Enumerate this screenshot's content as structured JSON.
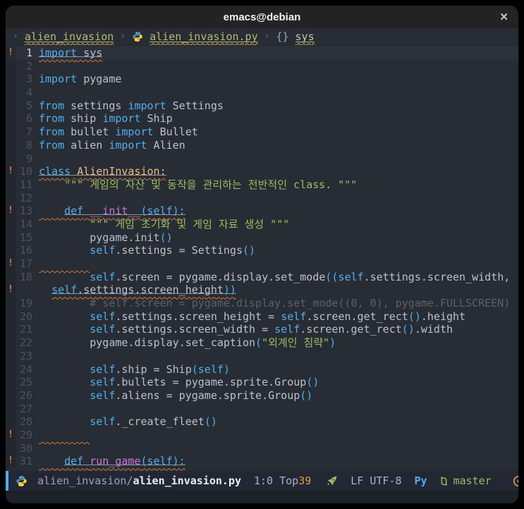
{
  "window": {
    "title": "emacs@debian",
    "close_label": "✕"
  },
  "breadcrumb": {
    "chevron": "›",
    "project": "alien_invasion",
    "file": "alien_invasion.py",
    "symbol_braces": "{}",
    "symbol": "sys"
  },
  "code": {
    "lines": [
      {
        "n": "1",
        "fringe": "!",
        "cur": true,
        "seg": [
          [
            "kw",
            "import",
            "uw"
          ],
          [
            "d",
            " sys",
            "uw"
          ]
        ]
      },
      {
        "n": "2",
        "seg": []
      },
      {
        "n": "3",
        "seg": [
          [
            "kw",
            "import"
          ],
          [
            "d",
            " pygame"
          ]
        ]
      },
      {
        "n": "4",
        "seg": []
      },
      {
        "n": "5",
        "seg": [
          [
            "kw",
            "from"
          ],
          [
            "d",
            " settings "
          ],
          [
            "kw",
            "import"
          ],
          [
            "d",
            " Settings"
          ]
        ]
      },
      {
        "n": "6",
        "seg": [
          [
            "kw",
            "from"
          ],
          [
            "d",
            " ship "
          ],
          [
            "kw",
            "import"
          ],
          [
            "d",
            " Ship"
          ]
        ]
      },
      {
        "n": "7",
        "seg": [
          [
            "kw",
            "from"
          ],
          [
            "d",
            " bullet "
          ],
          [
            "kw",
            "import"
          ],
          [
            "d",
            " Bullet"
          ]
        ]
      },
      {
        "n": "8",
        "seg": [
          [
            "kw",
            "from"
          ],
          [
            "d",
            " alien "
          ],
          [
            "kw",
            "import"
          ],
          [
            "d",
            " Alien"
          ]
        ]
      },
      {
        "n": "9",
        "seg": []
      },
      {
        "n": "10",
        "fringe": "!",
        "seg": [
          [
            "kw",
            "class",
            "uw"
          ],
          [
            "d",
            " ",
            "uw"
          ],
          [
            "type",
            "AlienInvasion",
            "uw"
          ],
          [
            "d",
            ":",
            "uw"
          ]
        ]
      },
      {
        "n": "11",
        "seg": [
          [
            "d",
            "    "
          ],
          [
            "str",
            "\"\"\" 게임의 자산 및 동작을 관리하는 전반적인 class. \"\"\""
          ]
        ]
      },
      {
        "n": "12",
        "seg": []
      },
      {
        "n": "13",
        "fringe": "!",
        "seg": [
          [
            "d",
            "    ",
            "w"
          ],
          [
            "kw",
            "def",
            "uw"
          ],
          [
            "d",
            " ",
            "uw"
          ],
          [
            "fn",
            "__init__",
            "uw"
          ],
          [
            "kw",
            "(self):",
            "uw"
          ]
        ]
      },
      {
        "n": "14",
        "seg": [
          [
            "d",
            "        "
          ],
          [
            "str",
            "\"\"\" 게임 초기화 및 게임 자료 생성 \"\"\""
          ]
        ]
      },
      {
        "n": "15",
        "seg": [
          [
            "d",
            "        pygame.init"
          ],
          [
            "kw",
            "()"
          ]
        ]
      },
      {
        "n": "16",
        "seg": [
          [
            "d",
            "        "
          ],
          [
            "kw",
            "self"
          ],
          [
            "d",
            ".settings = Settings"
          ],
          [
            "kw",
            "()"
          ]
        ]
      },
      {
        "n": "17",
        "fringe": "!",
        "seg": [
          [
            "d",
            "        ",
            "w"
          ]
        ]
      },
      {
        "n": "18",
        "seg": [
          [
            "d",
            "        "
          ],
          [
            "kw",
            "self"
          ],
          [
            "d",
            ".screen = pygame.display.set_mode"
          ],
          [
            "kw",
            "(("
          ],
          [
            "kw",
            "self"
          ],
          [
            "d",
            ".settings.screen_width,"
          ]
        ]
      },
      {
        "n": "",
        "fringe": "!",
        "seg": [
          [
            "d",
            "  "
          ],
          [
            "kw",
            "self",
            "uw"
          ],
          [
            "d",
            ".settings.screen_height",
            "uw"
          ],
          [
            "kw",
            "))",
            "uw"
          ]
        ]
      },
      {
        "n": "19",
        "seg": [
          [
            "cmt",
            "        # self.screen = pygame.display.set_mode((0, 0), pygame.FULLSCREEN)"
          ]
        ]
      },
      {
        "n": "20",
        "seg": [
          [
            "d",
            "        "
          ],
          [
            "kw",
            "self"
          ],
          [
            "d",
            ".settings.screen_height = "
          ],
          [
            "kw",
            "self"
          ],
          [
            "d",
            ".screen.get_rect"
          ],
          [
            "kw",
            "()"
          ],
          [
            "d",
            ".height"
          ]
        ]
      },
      {
        "n": "21",
        "seg": [
          [
            "d",
            "        "
          ],
          [
            "kw",
            "self"
          ],
          [
            "d",
            ".settings.screen_width = "
          ],
          [
            "kw",
            "self"
          ],
          [
            "d",
            ".screen.get_rect"
          ],
          [
            "kw",
            "()"
          ],
          [
            "d",
            ".width"
          ]
        ]
      },
      {
        "n": "22",
        "seg": [
          [
            "d",
            "        pygame.display.set_caption"
          ],
          [
            "kw",
            "("
          ],
          [
            "str",
            "\"외계인 침략\""
          ],
          [
            "kw",
            ")"
          ]
        ]
      },
      {
        "n": "23",
        "seg": []
      },
      {
        "n": "24",
        "seg": [
          [
            "d",
            "        "
          ],
          [
            "kw",
            "self"
          ],
          [
            "d",
            ".ship = Ship"
          ],
          [
            "kw",
            "("
          ],
          [
            "kw",
            "self"
          ],
          [
            "kw",
            ")"
          ]
        ]
      },
      {
        "n": "25",
        "seg": [
          [
            "d",
            "        "
          ],
          [
            "kw",
            "self"
          ],
          [
            "d",
            ".bullets = pygame.sprite.Group"
          ],
          [
            "kw",
            "()"
          ]
        ]
      },
      {
        "n": "26",
        "seg": [
          [
            "d",
            "        "
          ],
          [
            "kw",
            "self"
          ],
          [
            "d",
            ".aliens = pygame.sprite.Group"
          ],
          [
            "kw",
            "()"
          ]
        ]
      },
      {
        "n": "27",
        "seg": []
      },
      {
        "n": "28",
        "seg": [
          [
            "d",
            "        "
          ],
          [
            "kw",
            "self"
          ],
          [
            "d",
            "._create_fleet"
          ],
          [
            "kw",
            "()"
          ]
        ]
      },
      {
        "n": "29",
        "fringe": "!",
        "seg": [
          [
            "d",
            "        ",
            "w"
          ]
        ]
      },
      {
        "n": "30",
        "seg": []
      },
      {
        "n": "31",
        "fringe": "!",
        "seg": [
          [
            "d",
            "    ",
            "w"
          ],
          [
            "kw",
            "def",
            "uw"
          ],
          [
            "d",
            " ",
            "uw"
          ],
          [
            "fn",
            "run_game",
            "uw"
          ],
          [
            "kw",
            "(self):",
            "uw"
          ]
        ]
      }
    ]
  },
  "modeline": {
    "dir": "alien_invasion/",
    "file": "alien_invasion.py",
    "position": "1:0",
    "scroll": "Top",
    "scroll_extra": "39",
    "encoding": "LF UTF-8",
    "mode": "Py",
    "branch": "master"
  },
  "colors": {
    "accent_blue": "#51afef",
    "string_green": "#98be65",
    "function_magenta": "#c678dd",
    "type_yellow": "#ecbe7b",
    "warning_orange": "#cf7a3d",
    "background": "#282c34",
    "foreground": "#bbc2cf"
  }
}
